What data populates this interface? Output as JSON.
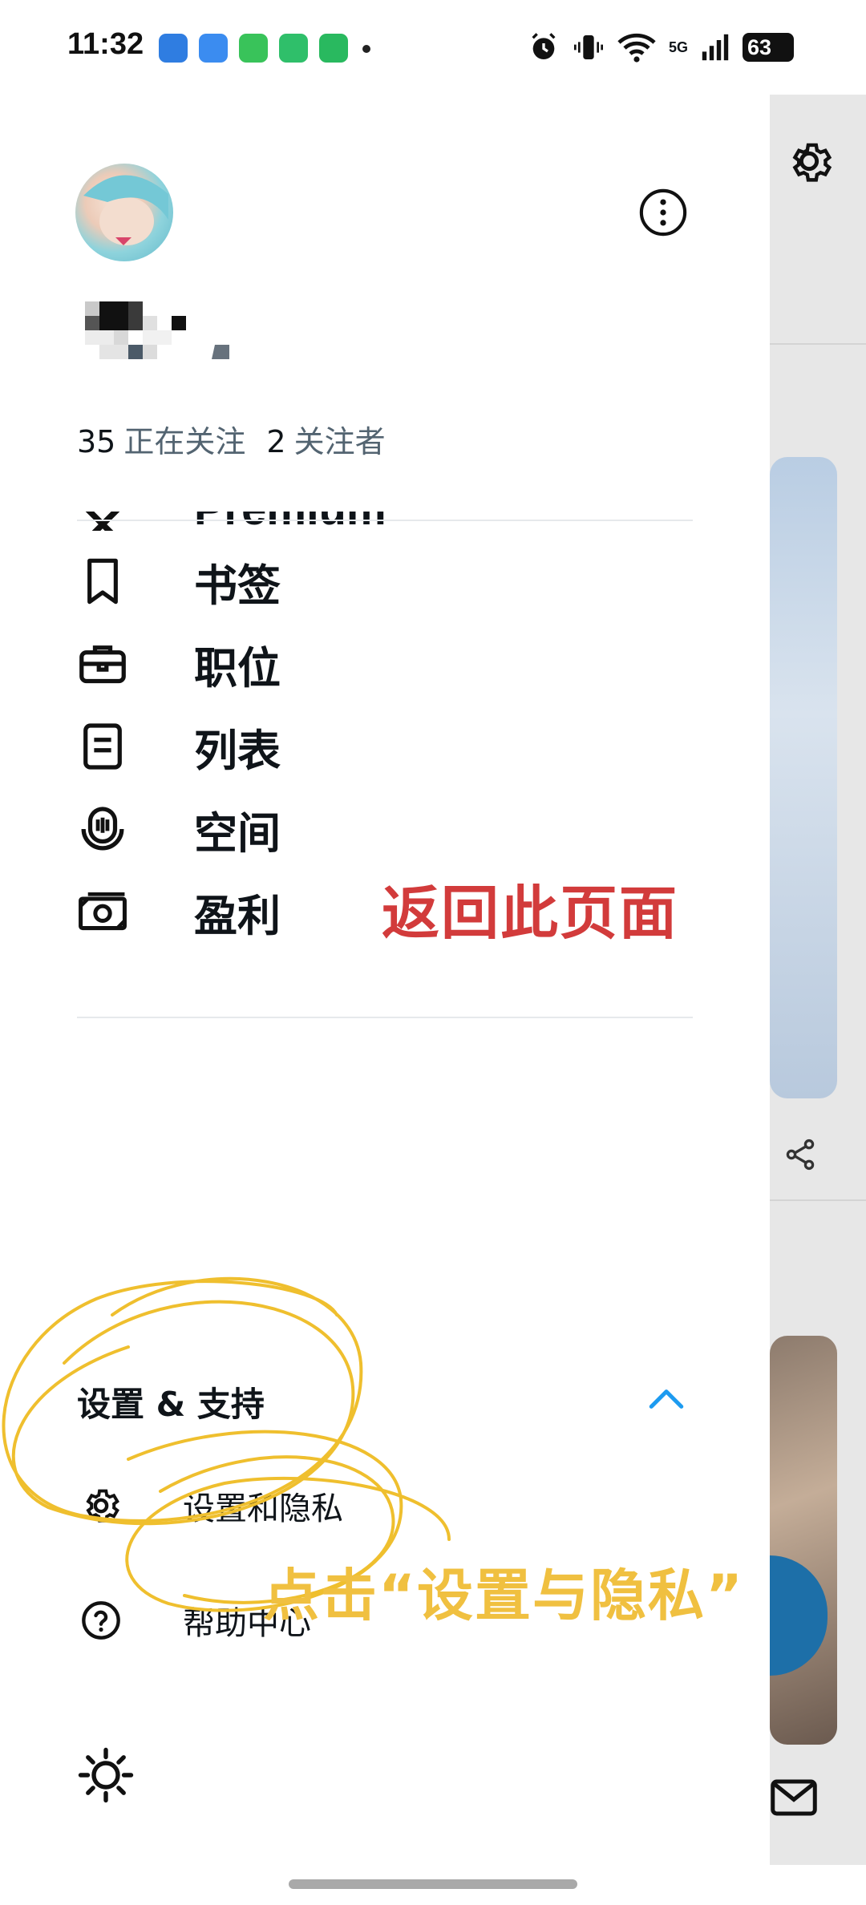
{
  "status_bar": {
    "time": "11:32",
    "network": "5G",
    "battery": "63",
    "app_icons": [
      "blue-app",
      "weather-app",
      "messages-app",
      "green-app",
      "shop-app"
    ],
    "right_icons": [
      "alarm-icon",
      "vibrate-icon",
      "wifi-icon",
      "signal-icon",
      "battery-icon"
    ]
  },
  "profile": {
    "following_count": "35",
    "following_label": "正在关注",
    "followers_count": "2",
    "followers_label": "关注者"
  },
  "menu": {
    "partial_item": "Premium",
    "items": [
      {
        "label": "书签",
        "icon": "bookmark-icon"
      },
      {
        "label": "职位",
        "icon": "briefcase-icon"
      },
      {
        "label": "列表",
        "icon": "list-icon"
      },
      {
        "label": "空间",
        "icon": "spaces-icon"
      },
      {
        "label": "盈利",
        "icon": "money-icon"
      }
    ]
  },
  "settings_section": {
    "title": "设置 & 支持",
    "items": [
      {
        "label": "设置和隐私",
        "icon": "gear-icon"
      },
      {
        "label": "帮助中心",
        "icon": "help-icon"
      }
    ]
  },
  "annotations": {
    "return_text": "返回此页面",
    "click_text": "点击“设置与隐私”"
  },
  "colors": {
    "accent": "#1d9bf0",
    "annotation_red": "#d23b3b",
    "annotation_yellow": "#f0c040"
  }
}
